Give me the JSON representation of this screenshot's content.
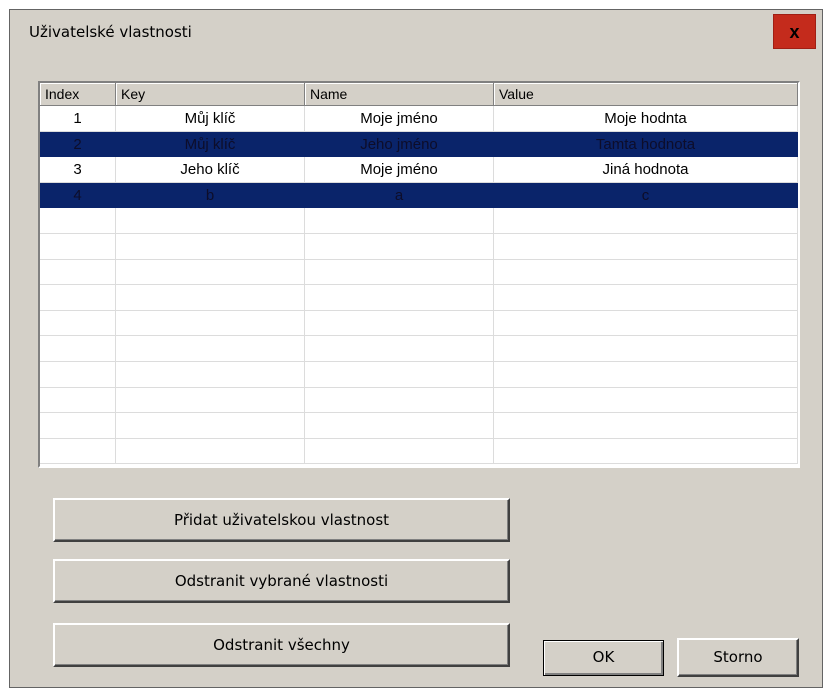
{
  "window": {
    "title": "Uživatelské vlastnosti",
    "close_label": "x"
  },
  "grid": {
    "columns": [
      "Index",
      "Key",
      "Name",
      "Value"
    ],
    "rows": [
      {
        "index": "1",
        "key": "Můj klíč",
        "name": "Moje jméno",
        "value": "Moje hodnta",
        "selected": false
      },
      {
        "index": "2",
        "key": "Můj klíč",
        "name": "Jeho jméno",
        "value": "Tamta hodnota",
        "selected": true
      },
      {
        "index": "3",
        "key": "Jeho klíč",
        "name": "Moje jméno",
        "value": "Jiná hodnota",
        "selected": false
      },
      {
        "index": "4",
        "key": "b",
        "name": "a",
        "value": "c",
        "selected": true
      },
      {
        "index": "",
        "key": "",
        "name": "",
        "value": "",
        "selected": false
      },
      {
        "index": "",
        "key": "",
        "name": "",
        "value": "",
        "selected": false
      },
      {
        "index": "",
        "key": "",
        "name": "",
        "value": "",
        "selected": false
      },
      {
        "index": "",
        "key": "",
        "name": "",
        "value": "",
        "selected": false
      },
      {
        "index": "",
        "key": "",
        "name": "",
        "value": "",
        "selected": false
      },
      {
        "index": "",
        "key": "",
        "name": "",
        "value": "",
        "selected": false
      },
      {
        "index": "",
        "key": "",
        "name": "",
        "value": "",
        "selected": false
      },
      {
        "index": "",
        "key": "",
        "name": "",
        "value": "",
        "selected": false
      },
      {
        "index": "",
        "key": "",
        "name": "",
        "value": "",
        "selected": false
      },
      {
        "index": "",
        "key": "",
        "name": "",
        "value": "",
        "selected": false
      }
    ]
  },
  "buttons": {
    "add": "Přidat uživatelskou vlastnost",
    "remove_selected": "Odstranit vybrané vlastnosti",
    "remove_all": "Odstranit všechny",
    "ok": "OK",
    "cancel": "Storno"
  },
  "colors": {
    "selection": "#0a246a",
    "close_button": "#c42b1c",
    "dialog_face": "#d4d0c8"
  }
}
